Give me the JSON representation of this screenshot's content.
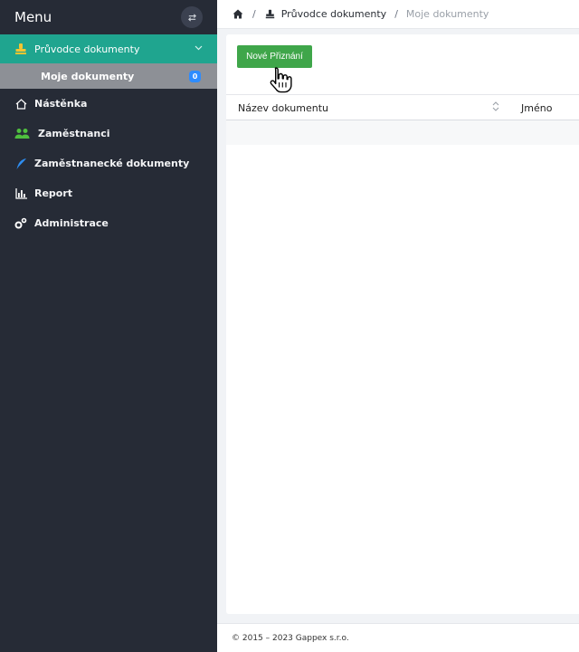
{
  "sidebar": {
    "title": "Menu",
    "active": {
      "label": "Průvodce dokumenty",
      "icon": "stamp-icon"
    },
    "sub": {
      "label": "Moje dokumenty",
      "badge": "0"
    },
    "items": [
      {
        "label": "Nástěnka",
        "icon": "home-outline-icon"
      },
      {
        "label": "Zaměstnanci",
        "icon": "users-icon"
      },
      {
        "label": "Zaměstnanecké dokumenty",
        "icon": "feather-icon"
      },
      {
        "label": "Report",
        "icon": "bar-chart-icon"
      },
      {
        "label": "Administrace",
        "icon": "gears-icon"
      }
    ]
  },
  "breadcrumb": {
    "sep": "/",
    "item1": "Průvodce dokumenty",
    "item2": "Moje dokumenty"
  },
  "main": {
    "new_button": "Nové Přiznání",
    "columns": [
      "Název dokumentu",
      "Jméno"
    ]
  },
  "footer": {
    "text": "© 2015 – 2023 Gappex s.r.o."
  },
  "colors": {
    "sidebar": "#262b36",
    "active": "#1fa58f",
    "button": "#3fa64a",
    "badge": "#2d8cff"
  }
}
